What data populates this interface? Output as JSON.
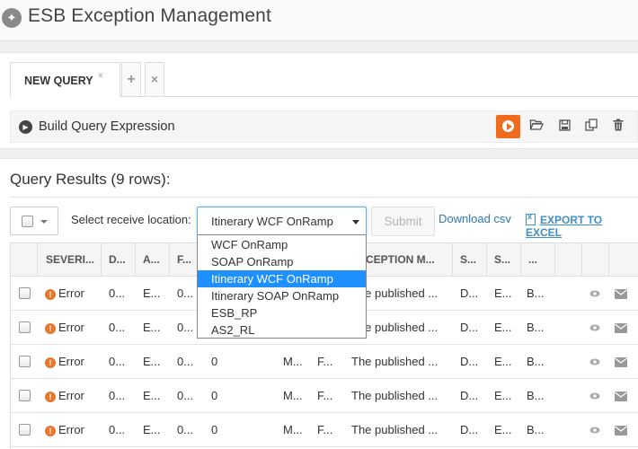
{
  "app": {
    "title": "ESB Exception Management",
    "logo_icon": "wrench-icon"
  },
  "query": {
    "tabs": [
      {
        "label": "NEW QUERY",
        "close": "×"
      }
    ],
    "add_tab": "+",
    "remove_tab": "×",
    "build_label": "Build Query Expression",
    "run_color": "#ef6b1f"
  },
  "results": {
    "title": "Query Results (9 rows):",
    "location_label": "Select receive location:",
    "location_selected": "Itinerary WCF OnRamp",
    "location_options": [
      "WCF OnRamp",
      "SOAP OnRamp",
      "Itinerary WCF OnRamp",
      "Itinerary SOAP OnRamp",
      "ESB_RP",
      "AS2_RL"
    ],
    "submit_label": "Submit",
    "download_label": "Download csv",
    "export_label": "EXPORT TO EXCEL",
    "columns": [
      "SEVERI...",
      "D...",
      "A...",
      "F...",
      "",
      "",
      "",
      "EXCEPTION M...",
      "S...",
      "S...",
      "..."
    ],
    "rows": [
      {
        "severity": "Error",
        "c1": "0...",
        "c2": "E...",
        "c3": "0...",
        "c4": "",
        "c5": "",
        "c6": "",
        "message": "The published ...",
        "c7": "D...",
        "c8": "E...",
        "c9": "B..."
      },
      {
        "severity": "Error",
        "c1": "0...",
        "c2": "E...",
        "c3": "0...",
        "c4": "",
        "c5": "",
        "c6": "",
        "message": "The published ...",
        "c7": "D...",
        "c8": "E...",
        "c9": "B..."
      },
      {
        "severity": "Error",
        "c1": "0...",
        "c2": "E...",
        "c3": "0...",
        "c4": "0",
        "c5": "M...",
        "c6": "F...",
        "message": "The published ...",
        "c7": "D...",
        "c8": "E...",
        "c9": "B..."
      },
      {
        "severity": "Error",
        "c1": "0...",
        "c2": "E...",
        "c3": "0...",
        "c4": "0",
        "c5": "M...",
        "c6": "F...",
        "message": "The published ...",
        "c7": "D...",
        "c8": "E...",
        "c9": "B..."
      },
      {
        "severity": "Error",
        "c1": "0...",
        "c2": "E...",
        "c3": "0...",
        "c4": "0",
        "c5": "M...",
        "c6": "F...",
        "message": "The published ...",
        "c7": "D...",
        "c8": "E...",
        "c9": "B..."
      }
    ]
  }
}
